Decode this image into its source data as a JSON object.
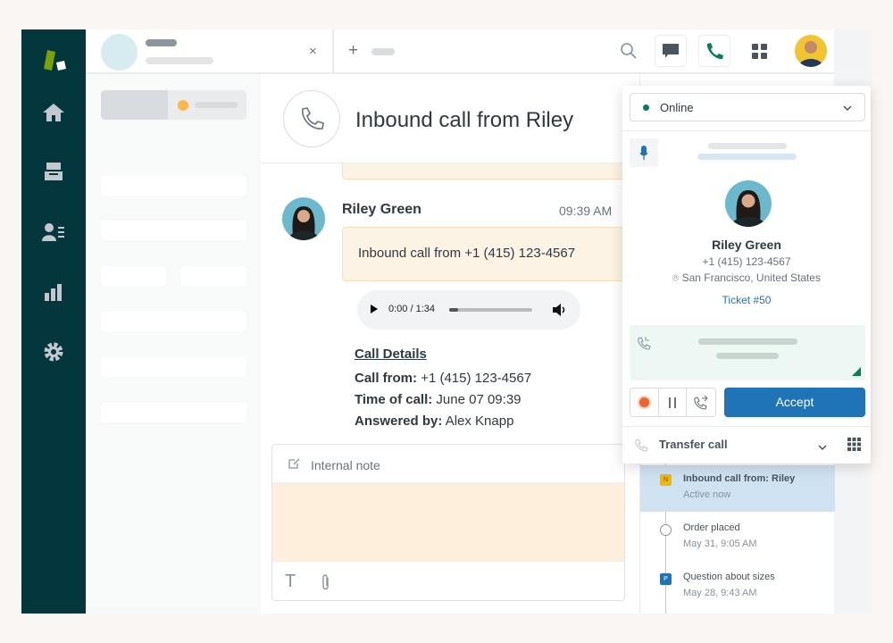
{
  "colors": {
    "nav_bg": "#03363d",
    "brand_green": "#78a300",
    "accept_blue": "#1f73b7",
    "online_green": "#038153",
    "note_bg": "#fdefdc"
  },
  "nav": {
    "items": [
      "home-icon",
      "views-icon",
      "customers-icon",
      "reporting-icon",
      "settings-icon"
    ]
  },
  "tabs": {
    "close_label": "×",
    "add_label": "+"
  },
  "ticket": {
    "title": "Inbound call from Riley",
    "message": {
      "author": "Riley Green",
      "time": "09:39 AM",
      "body": "Inbound call from +1 (415) 123-4567"
    },
    "audio": {
      "time": "0:00 / 1:34",
      "progress": 0.0
    },
    "details": {
      "heading": "Call Details",
      "rows": [
        {
          "label": "Call from:",
          "value": "+1 (415) 123-4567"
        },
        {
          "label": "Time of call:",
          "value": "June 07 09:39"
        },
        {
          "label": "Answered by:",
          "value": "Alex Knapp"
        }
      ]
    },
    "composer": {
      "mode": "Internal note"
    }
  },
  "talk": {
    "status": "Online",
    "caller": {
      "name": "Riley Green",
      "phone": "+1 (415) 123-4567",
      "location": "San Francisco, United States",
      "ticket": "Ticket #50"
    },
    "accept_label": "Accept",
    "transfer_label": "Transfer call"
  },
  "timeline": [
    {
      "badge": "N",
      "badge_color": "#f3b700",
      "title": "Inbound call from: Riley",
      "sub": "Active now",
      "active": true
    },
    {
      "badge": "",
      "title": "Order placed",
      "sub": "May 31, 9:05 AM",
      "active": false
    },
    {
      "badge": "P",
      "badge_color": "#1f73b7",
      "title": "Question about sizes",
      "sub": "May 28, 9:43 AM",
      "active": false
    }
  ]
}
